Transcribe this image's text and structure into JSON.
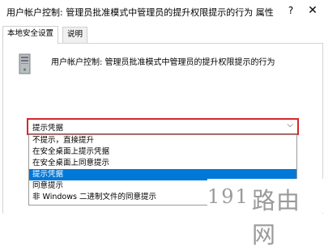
{
  "window": {
    "title": "用户帐户控制: 管理员批准模式中管理员的提升权限提示的行为 属性",
    "help_label": "?",
    "close_label": "✕"
  },
  "tabs": [
    {
      "label": "本地安全设置",
      "active": true
    },
    {
      "label": "说明",
      "active": false
    }
  ],
  "policy": {
    "icon": "server-icon",
    "name": "用户帐户控制: 管理员批准模式中管理员的提升权限提示的行为"
  },
  "dropdown": {
    "selected": "提示凭据",
    "chevron": "⌵",
    "options": [
      "不提示，直接提升",
      "在安全桌面上提示凭据",
      "在安全桌面上同意提示",
      "提示凭据",
      "同意提示",
      "非 Windows 二进制文件的同意提示"
    ],
    "highlighted_index": 3
  },
  "watermark": {
    "number": "191",
    "text": "路由网"
  },
  "colors": {
    "highlight": "#0078d7",
    "dropdown_border": "#d9262a",
    "watermark": "#9a9a9a"
  }
}
